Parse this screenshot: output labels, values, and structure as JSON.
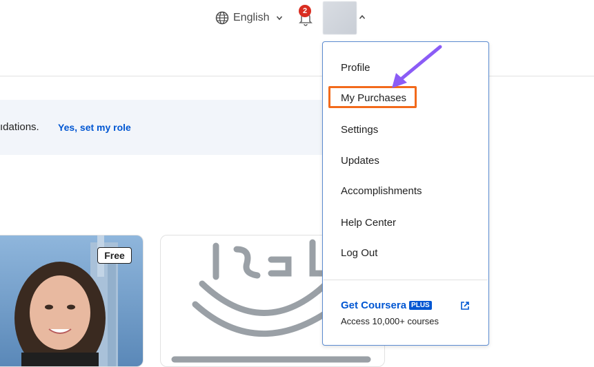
{
  "header": {
    "language_label": "English",
    "notification_count": "2"
  },
  "banner": {
    "text": "ıdations.",
    "link": "Yes, set my role"
  },
  "cards": {
    "badge": "Free"
  },
  "menu": {
    "items": [
      "Profile",
      "My Purchases",
      "Settings",
      "Updates",
      "Accomplishments",
      "Help Center",
      "Log Out"
    ],
    "plus_title": "Get Coursera",
    "plus_tag": "PLUS",
    "plus_subtitle": "Access 10,000+ courses"
  },
  "colors": {
    "link": "#0056d2",
    "highlight": "#f26a1b",
    "arrow": "#8b5cf6",
    "badge": "#d92d20"
  },
  "icons": [
    "globe-icon",
    "chevron-down-icon",
    "bell-icon",
    "chevron-up-icon",
    "external-link-icon"
  ]
}
